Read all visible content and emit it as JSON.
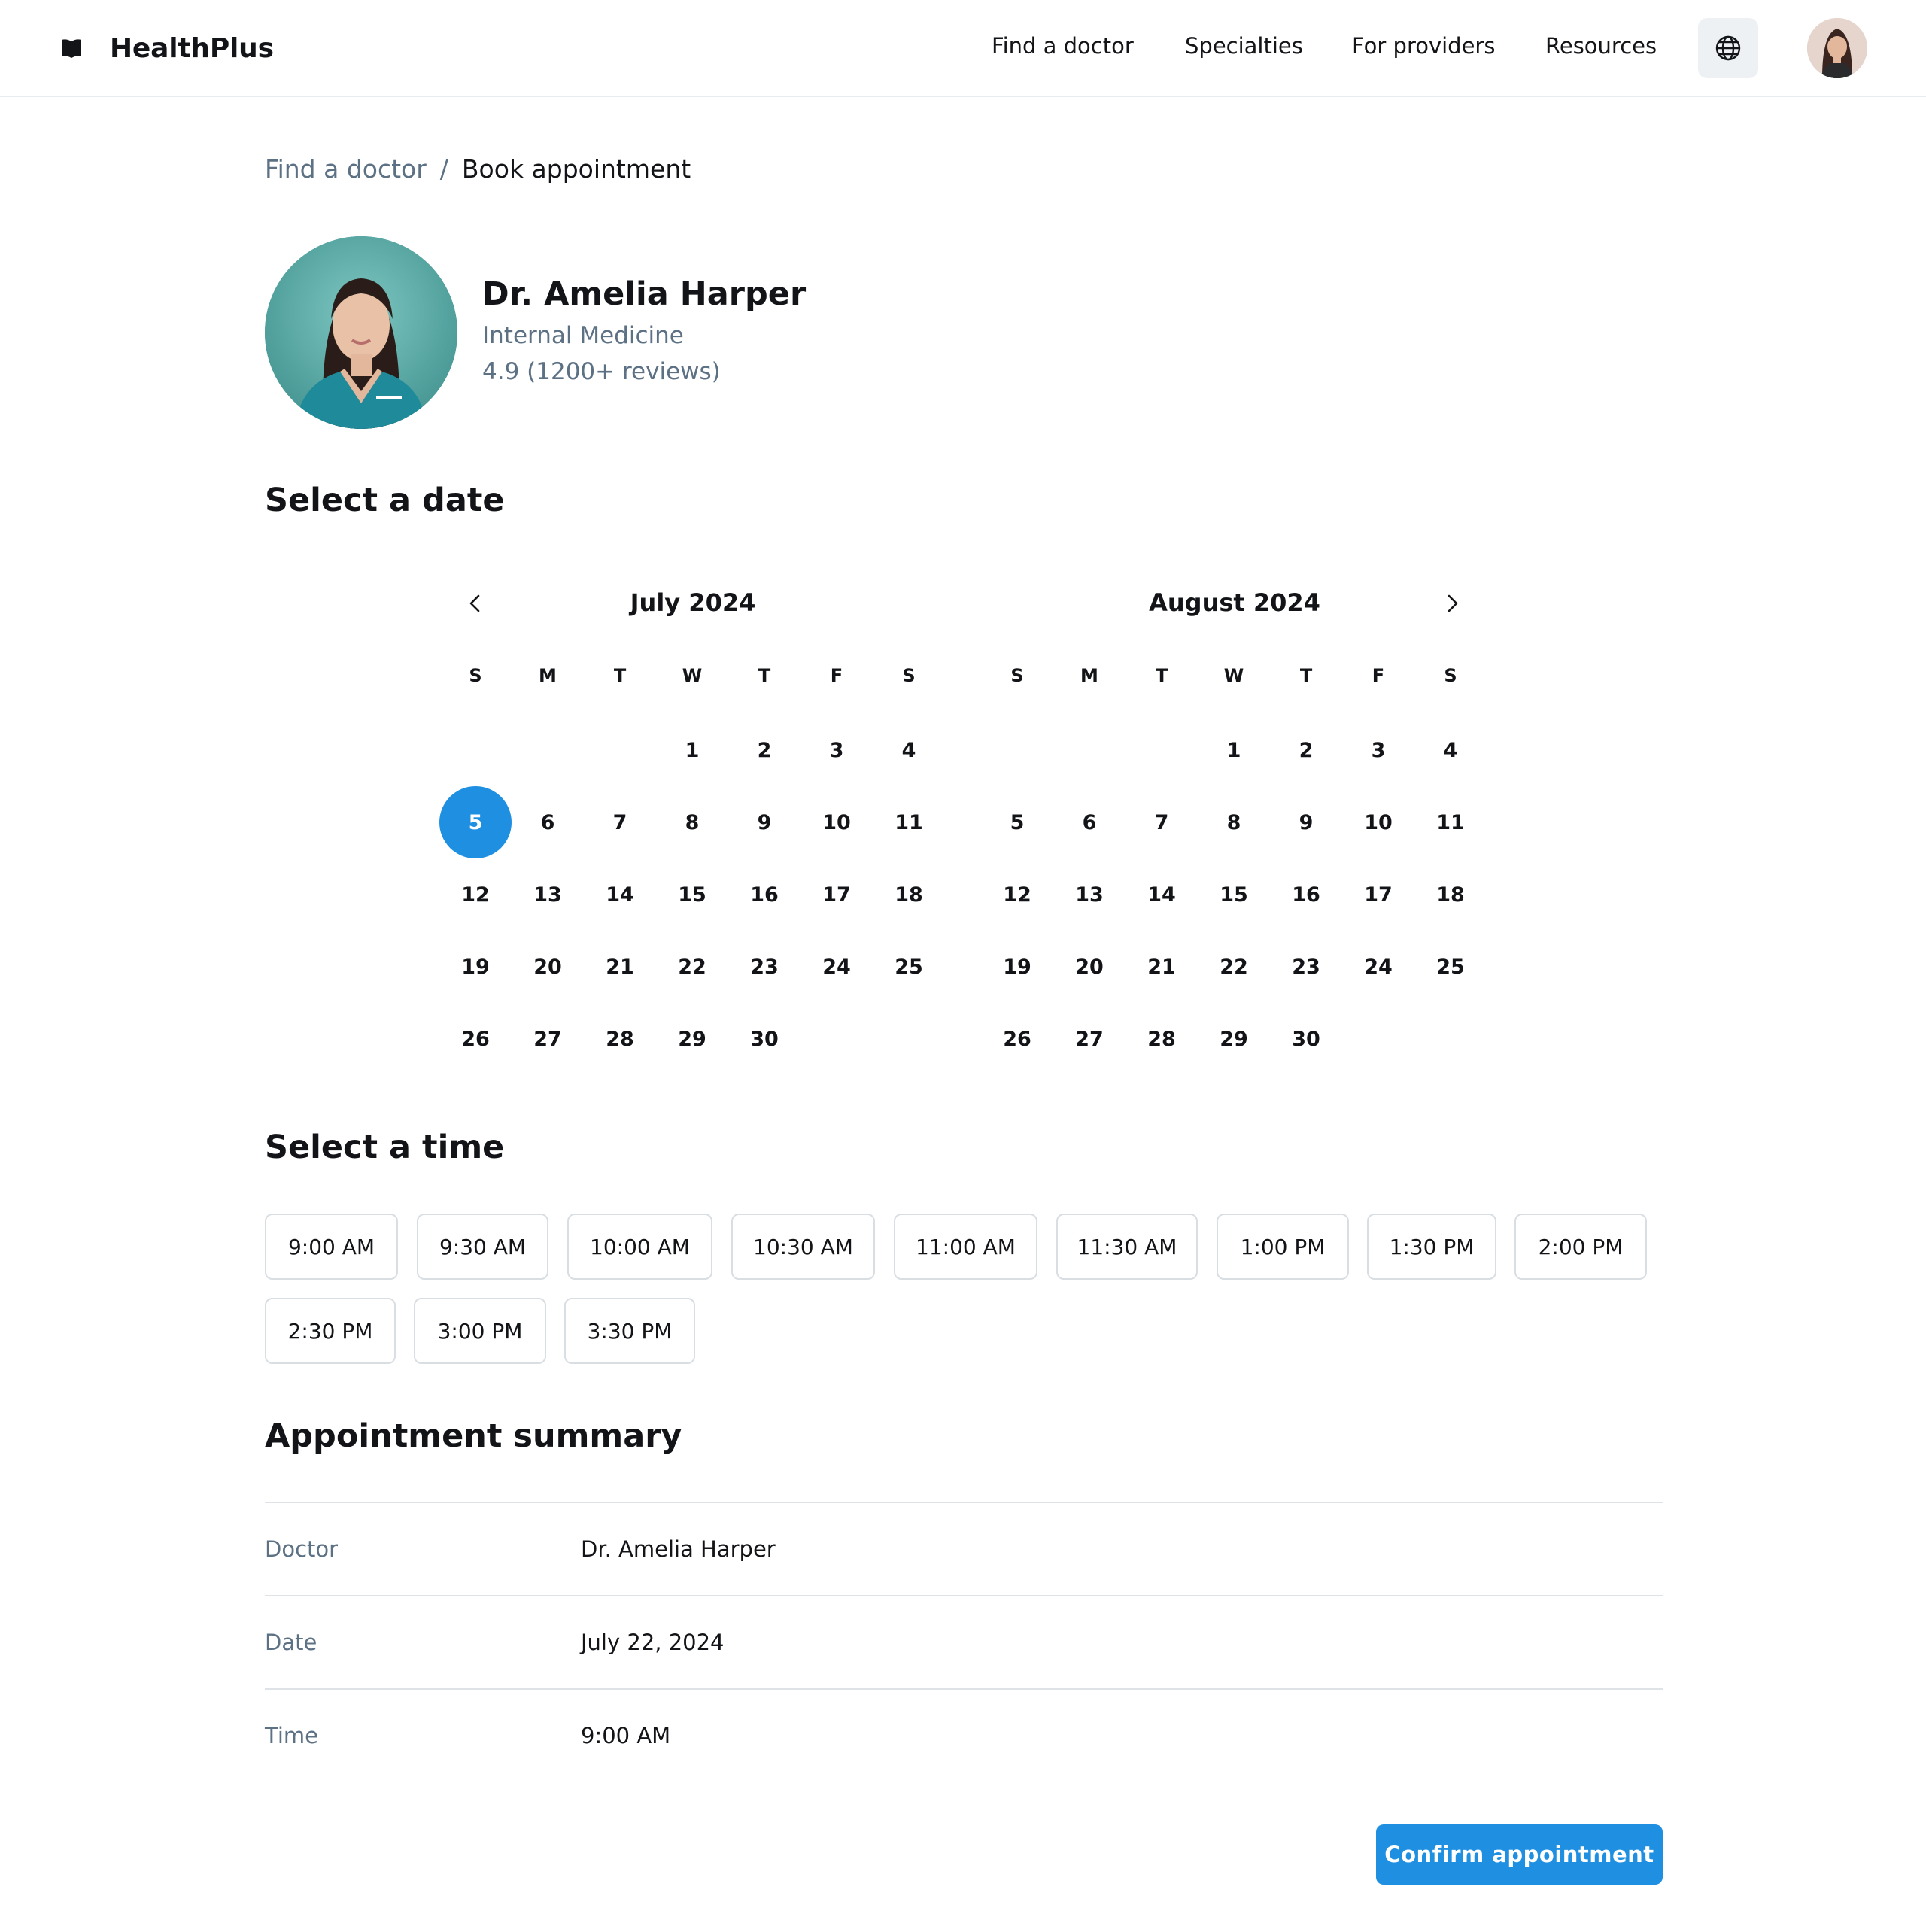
{
  "header": {
    "brand": "HealthPlus",
    "nav": [
      "Find a doctor",
      "Specialties",
      "For providers",
      "Resources"
    ]
  },
  "breadcrumb": {
    "parent": "Find a doctor",
    "separator": "/",
    "current": "Book appointment"
  },
  "doctor": {
    "name": "Dr. Amelia Harper",
    "specialty": "Internal Medicine",
    "rating": "4.9 (1200+ reviews)"
  },
  "date_section": {
    "title": "Select a date",
    "weekdays": [
      "S",
      "M",
      "T",
      "W",
      "T",
      "F",
      "S"
    ],
    "months": [
      {
        "title": "July 2024",
        "days": [
          "",
          "",
          "",
          "1",
          "2",
          "3",
          "4",
          "5",
          "6",
          "7",
          "8",
          "9",
          "10",
          "11",
          "12",
          "13",
          "14",
          "15",
          "16",
          "17",
          "18",
          "19",
          "20",
          "21",
          "22",
          "23",
          "24",
          "25",
          "26",
          "27",
          "28",
          "29",
          "30"
        ],
        "selected_day": "5"
      },
      {
        "title": "August 2024",
        "days": [
          "",
          "",
          "",
          "1",
          "2",
          "3",
          "4",
          "5",
          "6",
          "7",
          "8",
          "9",
          "10",
          "11",
          "12",
          "13",
          "14",
          "15",
          "16",
          "17",
          "18",
          "19",
          "20",
          "21",
          "22",
          "23",
          "24",
          "25",
          "26",
          "27",
          "28",
          "29",
          "30"
        ],
        "selected_day": ""
      }
    ]
  },
  "time_section": {
    "title": "Select a time",
    "slots": [
      "9:00 AM",
      "9:30 AM",
      "10:00 AM",
      "10:30 AM",
      "11:00 AM",
      "11:30 AM",
      "1:00 PM",
      "1:30 PM",
      "2:00 PM",
      "2:30 PM",
      "3:00 PM",
      "3:30 PM"
    ]
  },
  "summary": {
    "title": "Appointment summary",
    "rows": [
      {
        "label": "Doctor",
        "value": "Dr. Amelia Harper"
      },
      {
        "label": "Date",
        "value": "July 22, 2024"
      },
      {
        "label": "Time",
        "value": "9:00 AM"
      }
    ]
  },
  "actions": {
    "confirm": "Confirm appointment"
  },
  "colors": {
    "accent": "#1e8fe1",
    "muted_text": "#5d7185",
    "border": "#d9dee3"
  },
  "icons": {
    "brand": "book-icon",
    "language": "globe-icon",
    "prev": "chevron-left-icon",
    "next": "chevron-right-icon"
  }
}
